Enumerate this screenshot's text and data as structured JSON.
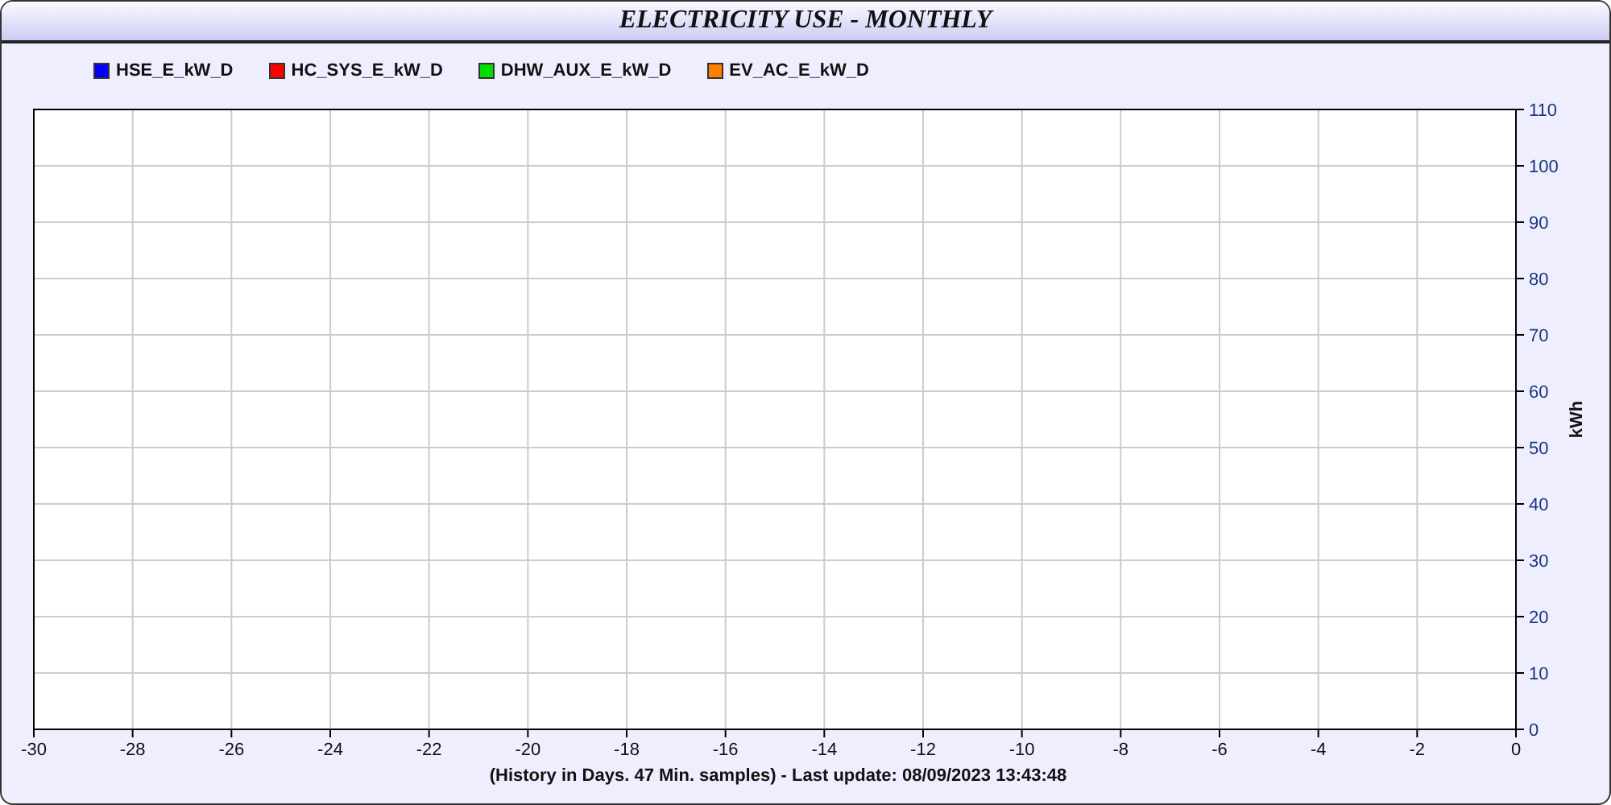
{
  "title": "ELECTRICITY USE - MONTHLY",
  "chart_data": {
    "type": "line",
    "xlabel": "(History in Days. 47 Min. samples) - Last update: 08/09/2023 13:43:48",
    "ylabel": "kWh",
    "series": [
      {
        "name": "HSE_E_kW_D",
        "color": "#0000ff",
        "values": [
          null,
          null,
          null,
          null,
          null,
          null,
          null,
          null,
          null,
          null,
          null,
          null,
          null,
          null,
          null,
          null
        ]
      },
      {
        "name": "HC_SYS_E_kW_D",
        "color": "#ff0000",
        "values": [
          null,
          null,
          null,
          null,
          null,
          null,
          null,
          null,
          null,
          null,
          null,
          null,
          null,
          null,
          null,
          null
        ]
      },
      {
        "name": "DHW_AUX_E_kW_D",
        "color": "#00dd00",
        "values": [
          null,
          null,
          null,
          null,
          null,
          null,
          null,
          null,
          null,
          null,
          null,
          null,
          null,
          null,
          null,
          null
        ]
      },
      {
        "name": "EV_AC_E_kW_D",
        "color": "#ff8000",
        "values": [
          null,
          null,
          null,
          null,
          null,
          null,
          null,
          null,
          null,
          null,
          null,
          null,
          null,
          null,
          null,
          null
        ]
      }
    ],
    "categories": [
      "-30",
      "-28",
      "-26",
      "-24",
      "-22",
      "-20",
      "-18",
      "-16",
      "-14",
      "-12",
      "-10",
      "-8",
      "-6",
      "-4",
      "-2",
      "0"
    ],
    "grid": true,
    "ylim": [
      0,
      110
    ],
    "yticks": [
      0,
      10,
      20,
      30,
      40,
      50,
      60,
      70,
      80,
      90,
      100,
      110
    ]
  }
}
